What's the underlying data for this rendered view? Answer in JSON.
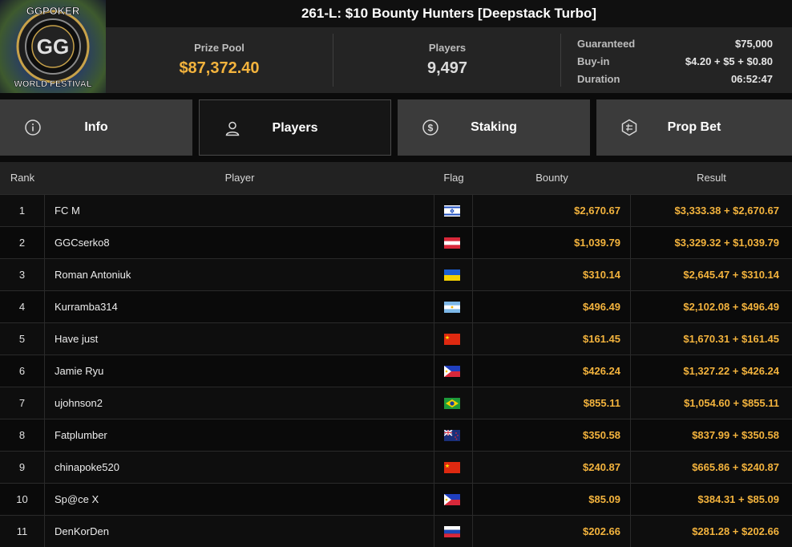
{
  "logo": {
    "top_text": "GGPOKER",
    "bottom_text": "WORLD FESTIVAL",
    "center_text": "GG"
  },
  "title": "261-L: $10 Bounty Hunters [Deepstack Turbo]",
  "stats": {
    "prize_pool_label": "Prize Pool",
    "prize_pool_value": "$87,372.40",
    "players_label": "Players",
    "players_value": "9,497"
  },
  "details": {
    "guaranteed_label": "Guaranteed",
    "guaranteed_value": "$75,000",
    "buyin_label": "Buy-in",
    "buyin_value": "$4.20 + $5 + $0.80",
    "duration_label": "Duration",
    "duration_value": "06:52:47"
  },
  "tabs": [
    {
      "label": "Info",
      "icon": "info-icon",
      "active": false
    },
    {
      "label": "Players",
      "icon": "user-icon",
      "active": true
    },
    {
      "label": "Staking",
      "icon": "dollar-coin-icon",
      "active": false
    },
    {
      "label": "Prop Bet",
      "icon": "prop-bet-icon",
      "active": false
    }
  ],
  "table": {
    "headers": {
      "rank": "Rank",
      "player": "Player",
      "flag": "Flag",
      "bounty": "Bounty",
      "result": "Result"
    },
    "rows": [
      {
        "rank": "1",
        "player": "FC M",
        "flag": "israel",
        "bounty": "$2,670.67",
        "result": "$3,333.38 + $2,670.67"
      },
      {
        "rank": "2",
        "player": "GGCserko8",
        "flag": "austria",
        "bounty": "$1,039.79",
        "result": "$3,329.32 + $1,039.79"
      },
      {
        "rank": "3",
        "player": "Roman Antoniuk",
        "flag": "ukraine",
        "bounty": "$310.14",
        "result": "$2,645.47 + $310.14"
      },
      {
        "rank": "4",
        "player": "Kurramba314",
        "flag": "argentina",
        "bounty": "$496.49",
        "result": "$2,102.08 + $496.49"
      },
      {
        "rank": "5",
        "player": "Have just",
        "flag": "china",
        "bounty": "$161.45",
        "result": "$1,670.31 + $161.45"
      },
      {
        "rank": "6",
        "player": "Jamie Ryu",
        "flag": "philippines",
        "bounty": "$426.24",
        "result": "$1,327.22 + $426.24"
      },
      {
        "rank": "7",
        "player": "ujohnson2",
        "flag": "brazil",
        "bounty": "$855.11",
        "result": "$1,054.60 + $855.11"
      },
      {
        "rank": "8",
        "player": "Fatplumber",
        "flag": "new-zealand",
        "bounty": "$350.58",
        "result": "$837.99 + $350.58"
      },
      {
        "rank": "9",
        "player": "chinapoke520",
        "flag": "china",
        "bounty": "$240.87",
        "result": "$665.86 + $240.87"
      },
      {
        "rank": "10",
        "player": "Sp@ce X",
        "flag": "philippines",
        "bounty": "$85.09",
        "result": "$384.31 + $85.09"
      },
      {
        "rank": "11",
        "player": "DenKorDen",
        "flag": "russia",
        "bounty": "$202.66",
        "result": "$281.28 + $202.66"
      }
    ]
  },
  "colors": {
    "gold": "#f3b33d",
    "tab_bg": "#3b3b3b",
    "tab_active_bg": "#161616"
  }
}
